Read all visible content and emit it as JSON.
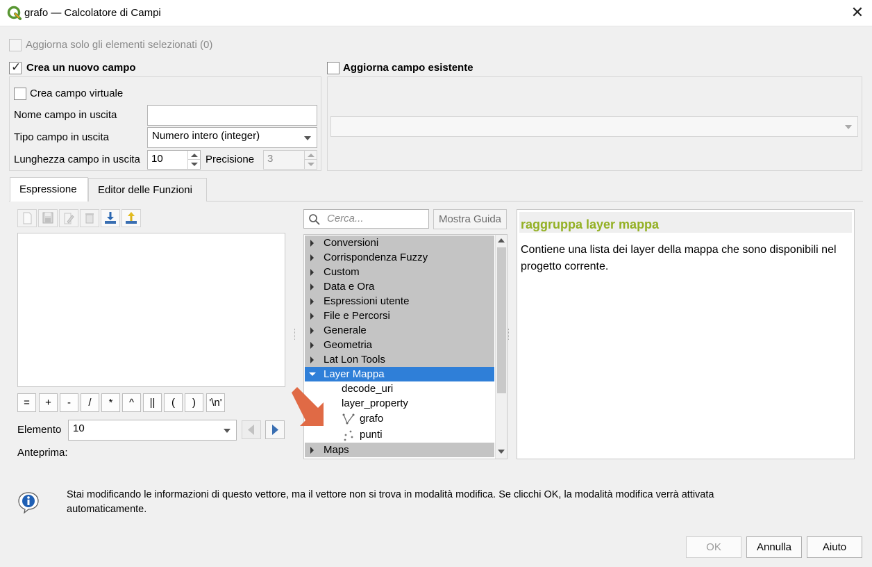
{
  "window": {
    "title": "grafo — Calcolatore di Campi",
    "close_icon": "close-icon"
  },
  "top": {
    "update_selected_label": "Aggiorna solo gli elementi selezionati (0)",
    "create_new_field_label": "Crea un nuovo campo",
    "create_new_field_checked": true,
    "update_existing_label": "Aggiorna campo esistente",
    "update_existing_checked": false
  },
  "new_field": {
    "virtual_label": "Crea campo virtuale",
    "name_label": "Nome campo in uscita",
    "name_value": "",
    "type_label": "Tipo campo in uscita",
    "type_value": "Numero intero (integer)",
    "length_label": "Lunghezza campo in uscita",
    "length_value": "10",
    "precision_label": "Precisione",
    "precision_value": "3"
  },
  "existing_field": {
    "selected_value": ""
  },
  "tabs": [
    {
      "label": "Espressione",
      "active": true
    },
    {
      "label": "Editor delle Funzioni",
      "active": false
    }
  ],
  "expression": {
    "toolbar_icons": [
      "new-file-icon",
      "save-icon",
      "edit-icon",
      "delete-icon",
      "import-icon",
      "export-icon"
    ],
    "text": "",
    "operators": [
      "=",
      "+",
      "-",
      "/",
      "*",
      "^",
      "||",
      "(",
      ")",
      "'\\n'"
    ],
    "element_label": "Elemento",
    "element_value": "10",
    "preview_label": "Anteprima:",
    "preview_value": ""
  },
  "search": {
    "placeholder": "Cerca...",
    "show_help_label": "Mostra Guida"
  },
  "function_tree": {
    "groups": [
      {
        "label": "Conversioni"
      },
      {
        "label": "Corrispondenza Fuzzy"
      },
      {
        "label": "Custom"
      },
      {
        "label": "Data e Ora"
      },
      {
        "label": "Espressioni utente"
      },
      {
        "label": "File e Percorsi"
      },
      {
        "label": "Generale"
      },
      {
        "label": "Geometria"
      },
      {
        "label": "Lat Lon Tools"
      },
      {
        "label": "Layer Mappa",
        "expanded": true,
        "selected": true
      },
      {
        "label": "Maps"
      }
    ],
    "children": [
      {
        "label": "decode_uri",
        "icon": ""
      },
      {
        "label": "layer_property",
        "icon": ""
      },
      {
        "label": "grafo",
        "icon": "line-layer-icon"
      },
      {
        "label": "punti",
        "icon": "point-layer-icon"
      }
    ]
  },
  "help": {
    "title": "raggruppa layer mappa",
    "body": "Contiene una lista dei layer della mappa che sono disponibili nel progetto corrente.",
    "title_color": "#93b023"
  },
  "info": {
    "icon": "info-icon",
    "message_line1": "Stai modificando le informazioni di questo vettore, ma il vettore non si trova in modalità modifica. Se clicchi OK, la modalità modifica verrà attivata",
    "message_line2": "automaticamente."
  },
  "buttons": {
    "ok": "OK",
    "cancel": "Annulla",
    "help": "Aiuto"
  },
  "colors": {
    "selection": "#2f7fd8",
    "arrow_annotation": "#e06a45"
  }
}
